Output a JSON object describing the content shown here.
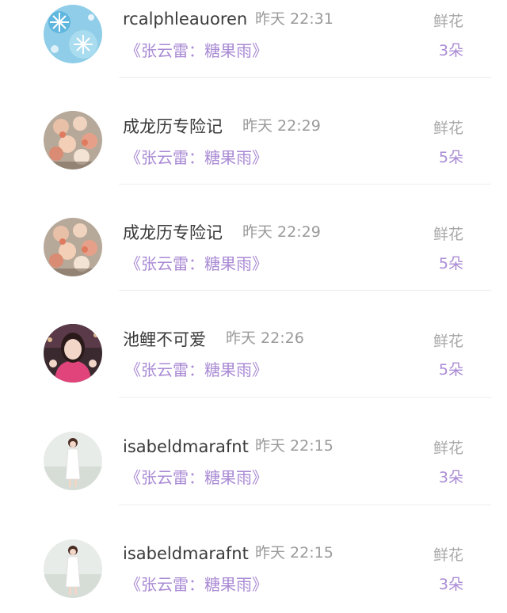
{
  "colors": {
    "name_text": "#3a3a3a",
    "time_text": "#9a9a9a",
    "song_text": "#a98ad4",
    "gift_label": "#a8a8a8",
    "gift_count": "#a98ad4",
    "divider": "#ededed"
  },
  "rows": [
    {
      "username": "rcalphleauoren",
      "time": "昨天 22:31",
      "song": "《张云雷：糖果雨》",
      "gift": "鲜花",
      "count": "3朵",
      "avatar_icon": "snowflake-avatar"
    },
    {
      "username": "成龙历专险记",
      "time": "昨天 22:29",
      "song": "《张云雷：糖果雨》",
      "gift": "鲜花",
      "count": "5朵",
      "avatar_icon": "flowers-avatar"
    },
    {
      "username": "成龙历专险记",
      "time": "昨天 22:29",
      "song": "《张云雷：糖果雨》",
      "gift": "鲜花",
      "count": "5朵",
      "avatar_icon": "flowers-avatar"
    },
    {
      "username": "池鲤不可爱",
      "time": "昨天 22:26",
      "song": "《张云雷：糖果雨》",
      "gift": "鲜花",
      "count": "5朵",
      "avatar_icon": "girl-photo-avatar"
    },
    {
      "username": "isabeldmarafnt",
      "time": "昨天 22:15",
      "song": "《张云雷：糖果雨》",
      "gift": "鲜花",
      "count": "3朵",
      "avatar_icon": "woman-white-dress-avatar"
    },
    {
      "username": "isabeldmarafnt",
      "time": "昨天 22:15",
      "song": "《张云雷：糖果雨》",
      "gift": "鲜花",
      "count": "3朵",
      "avatar_icon": "woman-white-dress-avatar"
    }
  ]
}
